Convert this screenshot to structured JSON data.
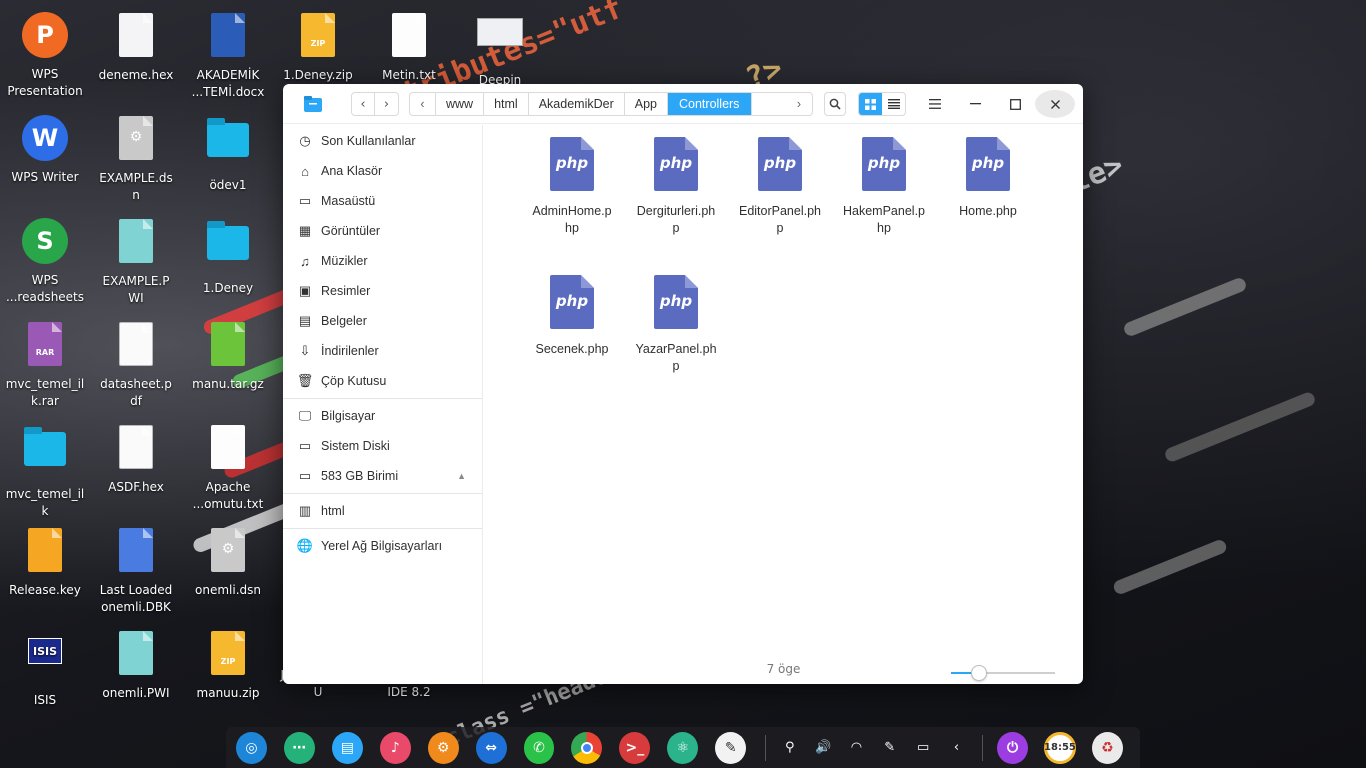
{
  "desktop": {
    "icons": [
      {
        "label": "WPS\nPresentation",
        "icon": "wps-presentation-icon"
      },
      {
        "label": "deneme.hex",
        "icon": "blank-file-icon"
      },
      {
        "label": "AKADEMİK\n...TEMİ.docx",
        "icon": "word-document-icon"
      },
      {
        "label": "1.Deney.zip",
        "icon": "zip-archive-icon"
      },
      {
        "label": "Metin.txt",
        "icon": "text-file-icon"
      },
      {
        "label": "Deepin",
        "icon": "screenshot-image-icon"
      },
      {
        "label": "WPS Writer",
        "icon": "wps-writer-icon"
      },
      {
        "label": "EXAMPLE.ds\nn",
        "icon": "config-file-icon"
      },
      {
        "label": "ödev1",
        "icon": "folder-icon"
      },
      {
        "label": "WPS\n...readsheets",
        "icon": "wps-spreadsheets-icon"
      },
      {
        "label": "EXAMPLE.P\nWI",
        "icon": "pwi-file-icon"
      },
      {
        "label": "1.Deney",
        "icon": "folder-icon"
      },
      {
        "label": "mvc_temel_il\nk.rar",
        "icon": "rar-archive-icon"
      },
      {
        "label": "datasheet.p\ndf",
        "icon": "pdf-file-icon"
      },
      {
        "label": "manu.tar.gz",
        "icon": "tar-archive-icon"
      },
      {
        "label": "mvc_temel_il\nk",
        "icon": "folder-icon"
      },
      {
        "label": "ASDF.hex",
        "icon": "hex-file-icon"
      },
      {
        "label": "Apache\n...omutu.txt",
        "icon": "text-file-icon"
      },
      {
        "label": "Release.key",
        "icon": "key-file-icon"
      },
      {
        "label": "Last Loaded\nonemli.DBK",
        "icon": "dbk-file-icon"
      },
      {
        "label": "onemli.dsn",
        "icon": "config-file-icon"
      },
      {
        "label": "ISIS",
        "icon": "isis-app-icon"
      },
      {
        "label": "onemli.PWI",
        "icon": "pwi-file-icon"
      },
      {
        "label": "manuu.zip",
        "icon": "zip-archive-icon"
      },
      {
        "label": "JDK_KLASOR\nU",
        "icon": "folder-icon"
      },
      {
        "label": "NetBeans\nIDE 8.2",
        "icon": "netbeans-icon"
      }
    ]
  },
  "window": {
    "nav": {
      "back": "‹",
      "forward": "›"
    },
    "breadcrumb": [
      "www",
      "html",
      "AkademikDer",
      "App",
      "Controllers"
    ],
    "sidebar": {
      "places": [
        "Son Kullanılanlar",
        "Ana Klasör",
        "Masaüstü",
        "Görüntüler",
        "Müzikler",
        "Resimler",
        "Belgeler",
        "İndirilenler",
        "Çöp Kutusu"
      ],
      "devices": [
        "Bilgisayar",
        "Sistem Diski",
        "583 GB Birimi"
      ],
      "bookmarks": [
        "html"
      ],
      "network": [
        "Yerel Ağ Bilgisayarları"
      ]
    },
    "files": [
      {
        "name": "AdminHome.p\nhp",
        "type": "php"
      },
      {
        "name": "Dergiturleri.ph\np",
        "type": "php"
      },
      {
        "name": "EditorPanel.ph\np",
        "type": "php"
      },
      {
        "name": "HakemPanel.p\nhp",
        "type": "php"
      },
      {
        "name": "Home.php",
        "type": "php"
      },
      {
        "name": "Secenek.php",
        "type": "php"
      },
      {
        "name": "YazarPanel.ph\np",
        "type": "php"
      }
    ],
    "php_label": "php",
    "status": "7 öge",
    "zoom_level": 0.27,
    "accent": "#2ca7f8",
    "php_color": "#5b6bc0"
  },
  "dock": {
    "apps": [
      "launcher-icon",
      "deepin-store-icon",
      "file-manager-icon",
      "music-icon",
      "settings-icon",
      "teamviewer-icon",
      "whatsapp-icon",
      "chrome-icon",
      "terminal-icon",
      "atom-icon",
      "text-editor-icon"
    ],
    "tray": [
      "usb-icon",
      "volume-icon",
      "wifi-icon",
      "pen-icon",
      "battery-icon",
      "chevron-left-icon"
    ],
    "clock": "18:55"
  }
}
